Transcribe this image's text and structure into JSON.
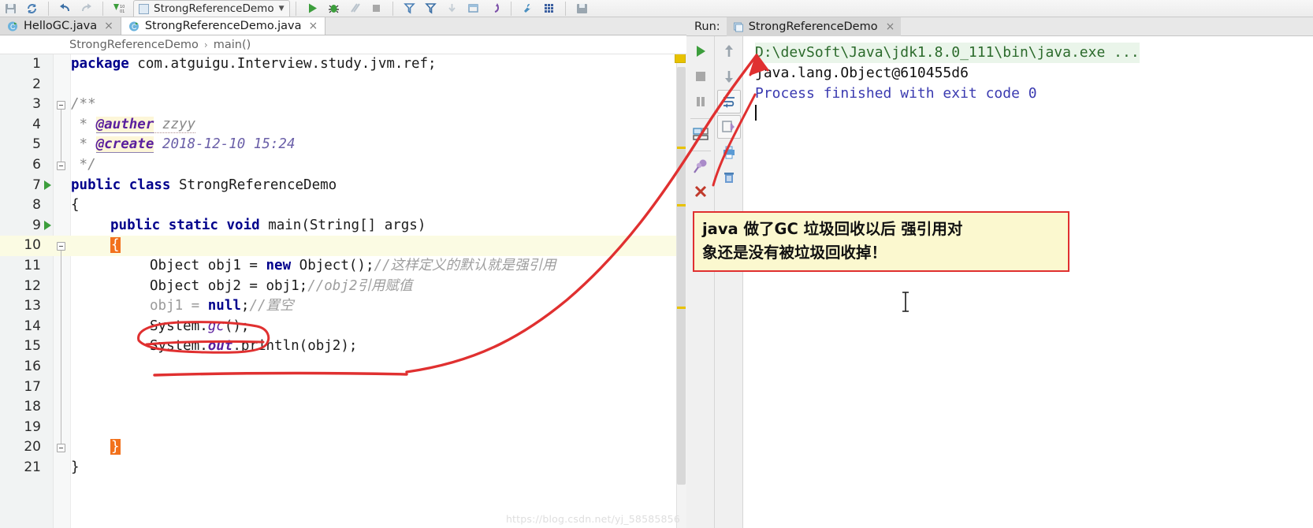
{
  "toolbar": {
    "run_config_name": "StrongReferenceDemo",
    "buttons": [
      {
        "name": "save-all-icon",
        "label": "Save All"
      },
      {
        "name": "sync-refresh-icon",
        "label": "Synchronize"
      },
      {
        "name": "undo-icon",
        "label": "Undo"
      },
      {
        "name": "redo-icon",
        "label": "Redo"
      },
      {
        "name": "compile-icon",
        "label": "Compile"
      },
      {
        "name": "run-icon",
        "label": "Run"
      },
      {
        "name": "debug-icon",
        "label": "Debug"
      },
      {
        "name": "run-coverage-icon",
        "label": "Run with Coverage"
      },
      {
        "name": "stop-icon",
        "label": "Stop"
      },
      {
        "name": "filter-icon",
        "label": "Filter"
      },
      {
        "name": "filter-down-icon",
        "label": "Filter Down"
      },
      {
        "name": "step-icon",
        "label": "Step"
      },
      {
        "name": "layout-icon",
        "label": "Layout"
      },
      {
        "name": "revert-icon",
        "label": "Revert"
      },
      {
        "name": "wrench-icon",
        "label": "Settings"
      },
      {
        "name": "grid-icon",
        "label": "Grid"
      },
      {
        "name": "save-icon",
        "label": "Save"
      }
    ]
  },
  "tabs": [
    {
      "label": "HelloGC.java",
      "active": false,
      "icon": "java-class-icon",
      "close": "×"
    },
    {
      "label": "StrongReferenceDemo.java",
      "active": true,
      "icon": "java-class-icon",
      "close": "×"
    }
  ],
  "breadcrumb": {
    "items": [
      "StrongReferenceDemo",
      "main()"
    ],
    "separator": "›"
  },
  "editor": {
    "lines": [
      {
        "num": "1",
        "text": "package com.atguigu.Interview.study.jvm.ref;"
      },
      {
        "num": "2",
        "text": ""
      },
      {
        "num": "3",
        "text": "/**"
      },
      {
        "num": "4",
        "text": " * @auther zzyy"
      },
      {
        "num": "5",
        "text": " * @create 2018-12-10 15:24"
      },
      {
        "num": "6",
        "text": " */"
      },
      {
        "num": "7",
        "text": "public class StrongReferenceDemo"
      },
      {
        "num": "8",
        "text": "{"
      },
      {
        "num": "9",
        "text": "    public static void main(String[] args)"
      },
      {
        "num": "10",
        "text": "    {"
      },
      {
        "num": "11",
        "text": "        Object obj1 = new Object();//这样定义的默认就是强引用"
      },
      {
        "num": "12",
        "text": "        Object obj2 = obj1;//obj2引用赋值"
      },
      {
        "num": "13",
        "text": "        obj1 = null;//置空"
      },
      {
        "num": "14",
        "text": "        System.gc();"
      },
      {
        "num": "15",
        "text": "        System.out.println(obj2);"
      },
      {
        "num": "16",
        "text": ""
      },
      {
        "num": "17",
        "text": ""
      },
      {
        "num": "18",
        "text": ""
      },
      {
        "num": "19",
        "text": "    }"
      },
      {
        "num": "20",
        "text": "}"
      },
      {
        "num": "21",
        "text": ""
      }
    ],
    "code": {
      "l1_kw": "package",
      "l1_rest": " com.atguigu.Interview.study.jvm.ref;",
      "l3": "/**",
      "l4_star": " * ",
      "l4_tag": "@auther",
      "l4_val": " zzyy",
      "l5_star": " * ",
      "l5_tag": "@create",
      "l5_val": " 2018-12-10 15:24",
      "l6": " */",
      "l7_kw1": "public",
      "l7_kw2": "class",
      "l7_name": "StrongReferenceDemo",
      "l8": "{",
      "l9_kw": "public static void",
      "l9_rest": " main(String[] args)",
      "l10": "{",
      "l11_a": "Object obj1 = ",
      "l11_kw": "new",
      "l11_b": " Object();",
      "l11_cmt": "//这样定义的默认就是强引用",
      "l12_a": "Object obj2 = obj1;",
      "l12_cmt": "//obj2引用赋值",
      "l13_a": "obj1 = ",
      "l13_kw": "null",
      "l13_b": ";",
      "l13_cmt": "//置空",
      "l14_a": "System.",
      "l14_m": "gc",
      "l14_b": "();",
      "l15_a": "System.",
      "l15_f": "out",
      "l15_b": ".println(obj2);",
      "l19": "}",
      "l20": "}"
    },
    "watermark": "https://blog.csdn.net/yj_58585856"
  },
  "run_panel": {
    "label": "Run:",
    "tab_name": "StrongReferenceDemo",
    "tab_close": "×",
    "toolbar_left": [
      {
        "name": "rerun-icon",
        "label": "Rerun"
      },
      {
        "name": "stop-icon",
        "label": "Stop"
      },
      {
        "name": "pause-icon",
        "label": "Pause Output"
      },
      {
        "name": "restore-layout-icon",
        "label": "Restore Layout"
      },
      {
        "name": "pin-tab-icon",
        "label": "Pin Tab"
      },
      {
        "name": "close-icon",
        "label": "Close"
      }
    ],
    "toolbar_right": [
      {
        "name": "arrow-up-icon",
        "label": "Up the Stack Trace"
      },
      {
        "name": "arrow-down-icon",
        "label": "Down the Stack Trace"
      },
      {
        "name": "soft-wrap-icon",
        "label": "Soft-Wrap"
      },
      {
        "name": "scroll-to-end-icon",
        "label": "Scroll to End"
      },
      {
        "name": "print-icon",
        "label": "Print"
      },
      {
        "name": "clear-all-icon",
        "label": "Clear All"
      }
    ],
    "console": {
      "command": "D:\\devSoft\\Java\\jdk1.8.0_111\\bin\\java.exe ...",
      "output": "java.lang.Object@610455d6",
      "blank": "",
      "exit": "Process finished with exit code 0"
    }
  },
  "annotation": {
    "line1": "java 做了GC 垃圾回收以后 强引用对",
    "line2": "象还是没有被垃圾回收掉！",
    "border_color": "#e03030",
    "background_color": "#fbf8cf"
  },
  "colors": {
    "keyword": "#00008c",
    "comment": "#9d9d9d",
    "javadoc_tag": "#5a1f9e",
    "console_path": "#2b6a2b",
    "console_exit": "#3a3ab0",
    "annotation_red": "#e03030",
    "caret_brace": "#f2711c",
    "run_green": "#3c9e3c",
    "marker_yellow": "#e8c200"
  }
}
